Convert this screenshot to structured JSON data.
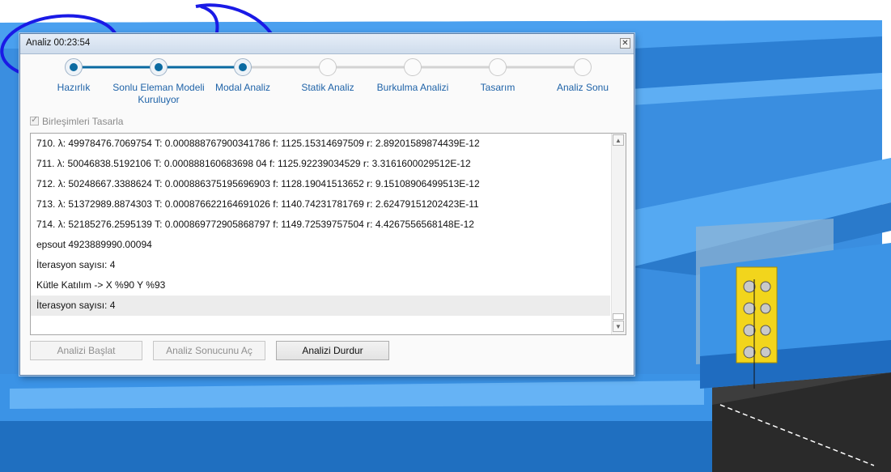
{
  "dialog": {
    "title": "Analiz 00:23:54",
    "close_glyph": "☒"
  },
  "steps": [
    {
      "label": "Hazırlık",
      "status": "done"
    },
    {
      "label": "Sonlu Eleman Modeli Kuruluyor",
      "status": "done"
    },
    {
      "label": "Modal Analiz",
      "status": "done"
    },
    {
      "label": "Statik Analiz",
      "status": "todo"
    },
    {
      "label": "Burkulma Analizi",
      "status": "todo"
    },
    {
      "label": "Tasarım",
      "status": "todo"
    },
    {
      "label": "Analiz Sonu",
      "status": "todo"
    }
  ],
  "options": {
    "design_connections_label": "Birleşimleri Tasarla",
    "design_connections_checked": true,
    "design_connections_enabled": false
  },
  "log": [
    "710. λ: 49978476.7069754 T: 0.000888767900341786 f: 1125.15314697509 r: 2.89201589874439E-12",
    "711. λ: 50046838.5192106 T: 0.000888160683698 04 f: 1125.92239034529 r: 3.3161600029512E-12",
    "712. λ: 50248667.3388624 T: 0.000886375195696903 f: 1128.19041513652 r: 9.15108906499513E-12",
    "713. λ: 51372989.8874303 T: 0.000876622164691026 f: 1140.74231781769 r: 2.62479151202423E-11",
    "714. λ: 52185276.2595139 T: 0.000869772905868797 f: 1149.72539757504 r: 4.4267556568148E-12",
    "epsout 4923889990.00094",
    "İterasyon sayısı:  4",
    "Kütle Katılım -> X %90 Y %93",
    "İterasyon sayısı: 4"
  ],
  "log_selected_index": 8,
  "buttons": {
    "start": "Analizi Başlat",
    "open_result": "Analiz Sonucunu Aç",
    "stop": "Analizi Durdur"
  },
  "colors": {
    "step_active": "#0b6aa1",
    "step_label": "#1f63a8",
    "annotation_ink": "#1a1ae6",
    "steel_blue": "#2f8fe0"
  },
  "icons": {
    "close": "close-icon",
    "scroll_up": "arrow-up-icon",
    "scroll_down": "arrow-down-icon",
    "checkbox": "checkmark-icon"
  }
}
